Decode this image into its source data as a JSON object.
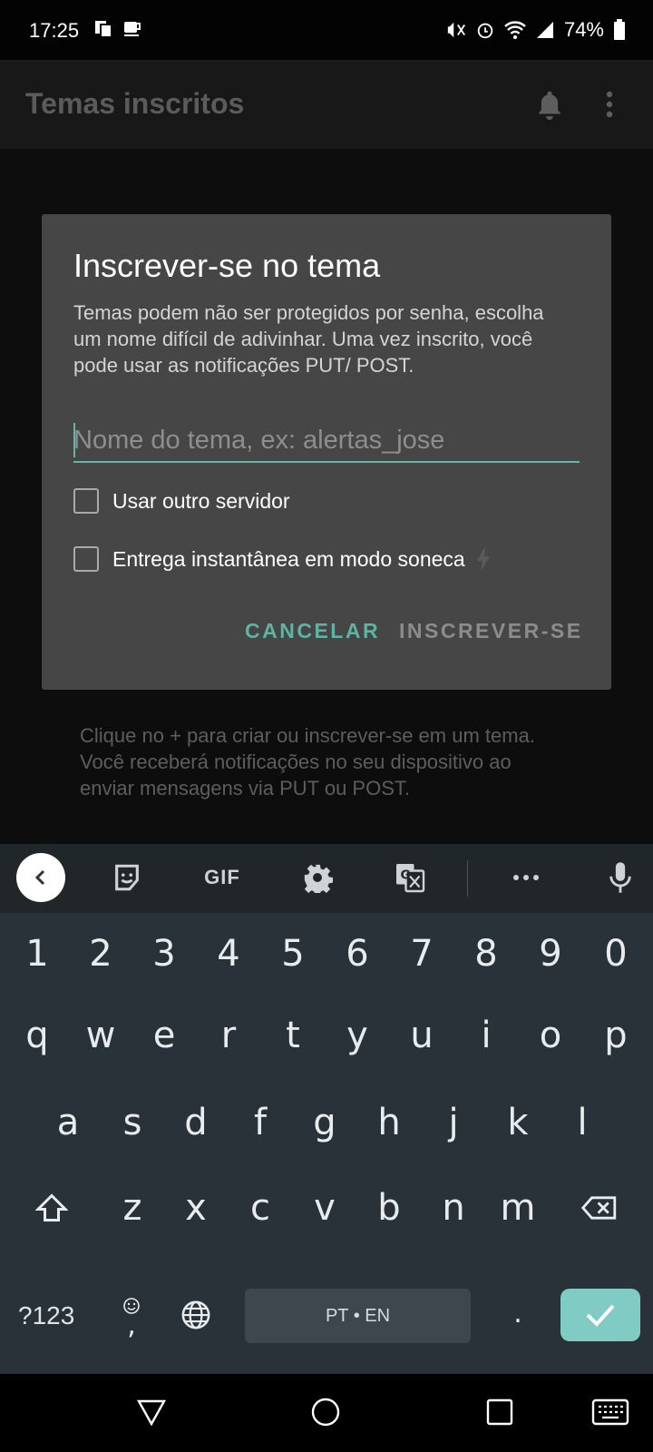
{
  "status_bar": {
    "time": "17:25",
    "battery": "74%",
    "icons": [
      "notification-icon",
      "coffee-icon",
      "vibrate-icon",
      "alarm-icon",
      "wifi-icon",
      "signal-icon",
      "battery-icon"
    ]
  },
  "app_bar": {
    "title": "Temas inscritos",
    "icons": [
      "bell-icon",
      "more-vert-icon"
    ]
  },
  "dialog": {
    "title": "Inscrever-se no tema",
    "body": "Temas podem não ser protegidos por senha, escolha um nome difícil de adivinhar. Uma vez inscrito, você pode usar as notificações PUT/ POST.",
    "input_placeholder": "Nome do tema, ex: alertas_jose",
    "input_value": "",
    "checkbox_other_server": {
      "label": "Usar outro servidor",
      "checked": false
    },
    "checkbox_instant": {
      "label": "Entrega instantânea em modo soneca",
      "checked": false
    },
    "cancel_label": "CANCELAR",
    "subscribe_label": "INSCREVER-SE"
  },
  "empty_state": {
    "text": "Clique no + para criar ou inscrever-se em um tema. Você receberá notificações no seu dispositivo ao enviar mensagens via PUT ou POST."
  },
  "keyboard": {
    "toolbar": {
      "gif_label": "GIF"
    },
    "row_numbers": [
      "1",
      "2",
      "3",
      "4",
      "5",
      "6",
      "7",
      "8",
      "9",
      "0"
    ],
    "row_q": [
      "q",
      "w",
      "e",
      "r",
      "t",
      "y",
      "u",
      "i",
      "o",
      "p"
    ],
    "row_a": [
      "a",
      "s",
      "d",
      "f",
      "g",
      "h",
      "j",
      "k",
      "l"
    ],
    "row_z": [
      "z",
      "x",
      "c",
      "v",
      "b",
      "n",
      "m"
    ],
    "symbols_label": "?123",
    "emoji_key_sub": ",",
    "space_label": "PT • EN",
    "period_label": "."
  },
  "colors": {
    "accent": "#62b7a7",
    "dialog_bg": "#464646",
    "keyboard_bg": "#293238",
    "enter_key": "#80cbc4"
  }
}
